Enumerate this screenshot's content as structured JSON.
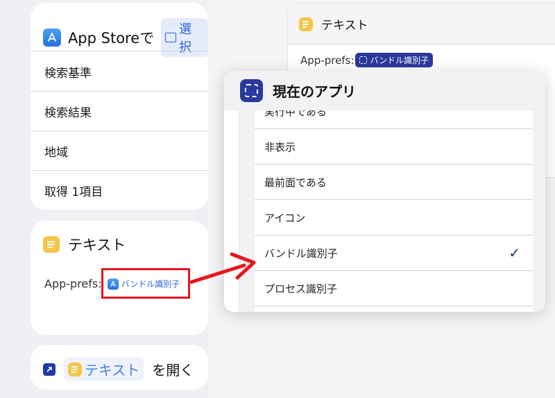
{
  "left": {
    "appstore_card": {
      "title": "App Storeで",
      "token_label": "選択",
      "rows": [
        "検索基準",
        "検索結果",
        "地域",
        "取得 1項目"
      ]
    },
    "text_card": {
      "title": "テキスト",
      "prefix": "App-prefs:",
      "token_label": "バンドル識別子"
    },
    "open_card": {
      "token_label": "テキスト",
      "suffix": "を開く"
    }
  },
  "right": {
    "text_card": {
      "title": "テキスト",
      "prefix": "App-prefs:",
      "token_label": "バンドル識別子"
    },
    "popup": {
      "title": "現在のアプリ",
      "items": [
        {
          "label": "実行中である",
          "checked": false
        },
        {
          "label": "非表示",
          "checked": false
        },
        {
          "label": "最前面である",
          "checked": false
        },
        {
          "label": "アイコン",
          "checked": false
        },
        {
          "label": "バンドル識別子",
          "checked": true
        },
        {
          "label": "プロセス識別子",
          "checked": false
        }
      ],
      "check_glyph": "✓"
    }
  },
  "colors": {
    "accent_red": "#e8141b",
    "token_blue": "#2c62d8",
    "token_dark": "#2a3a9c",
    "checkmark": "#1d2e7a"
  }
}
